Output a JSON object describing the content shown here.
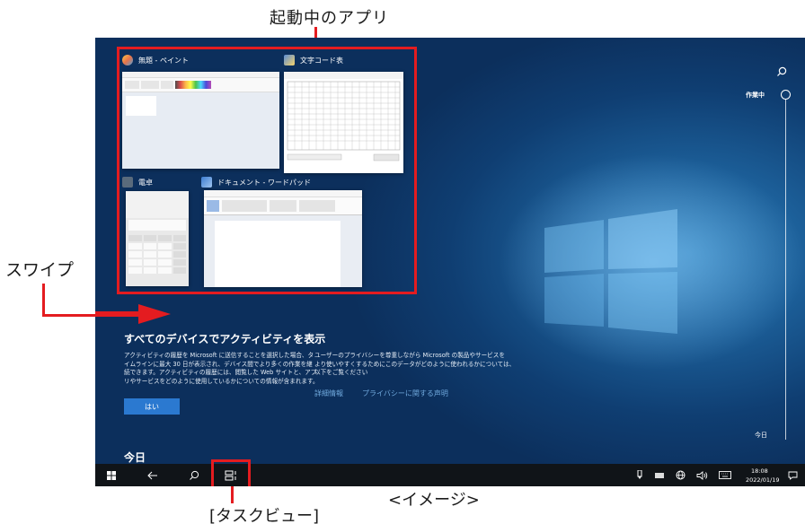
{
  "annotations": {
    "running_apps": "起動中のアプリ",
    "swipe": "スワイプ",
    "image_note": "<イメージ>",
    "task_view": "[タスクビュー]"
  },
  "windows": [
    {
      "title": "無題 - ペイント",
      "icon": "paint-icon"
    },
    {
      "title": "文字コード表",
      "icon": "character-map-icon"
    },
    {
      "title": "電卓",
      "icon": "calculator-icon"
    },
    {
      "title": "ドキュメント - ワードパッド",
      "icon": "wordpad-icon"
    }
  ],
  "activity": {
    "title": "すべてのデバイスでアクティビティを表示",
    "desc_left": [
      "アクティビティの履歴を Microsoft に送信することを選択した場合、タ",
      "イムラインに最大 30 日が表示され、デバイス間でより多くの作業を継",
      "続できます。アクティビティの履歴には、閲覧した Web サイトと、アプ",
      "リやサービスをどのように使用しているかについての情報が含まれます。"
    ],
    "desc_right": [
      "ユーザーのプライバシーを尊重しながら Microsoft の製品やサービスを",
      "より使いやすくするためにこのデータがどのように使われるかについては、",
      "以下をご覧ください"
    ],
    "link_details": "詳細情報",
    "link_privacy": "プライバシーに関する声明",
    "yes_button": "はい",
    "today_heading": "今日"
  },
  "timeline": {
    "working_label": "作業中",
    "today_label": "今日"
  },
  "taskbar": {
    "time": "18:08",
    "date": "2022/01/19",
    "icons": [
      "start-icon",
      "back-icon",
      "search-icon",
      "task-view-icon",
      "pen-icon",
      "touch-keyboard-tray-icon",
      "network-icon",
      "volume-icon",
      "keyboard-icon",
      "notification-icon"
    ]
  },
  "colors": {
    "highlight": "#e41c20",
    "accent": "#2b79d0",
    "taskbar": "#101418"
  }
}
